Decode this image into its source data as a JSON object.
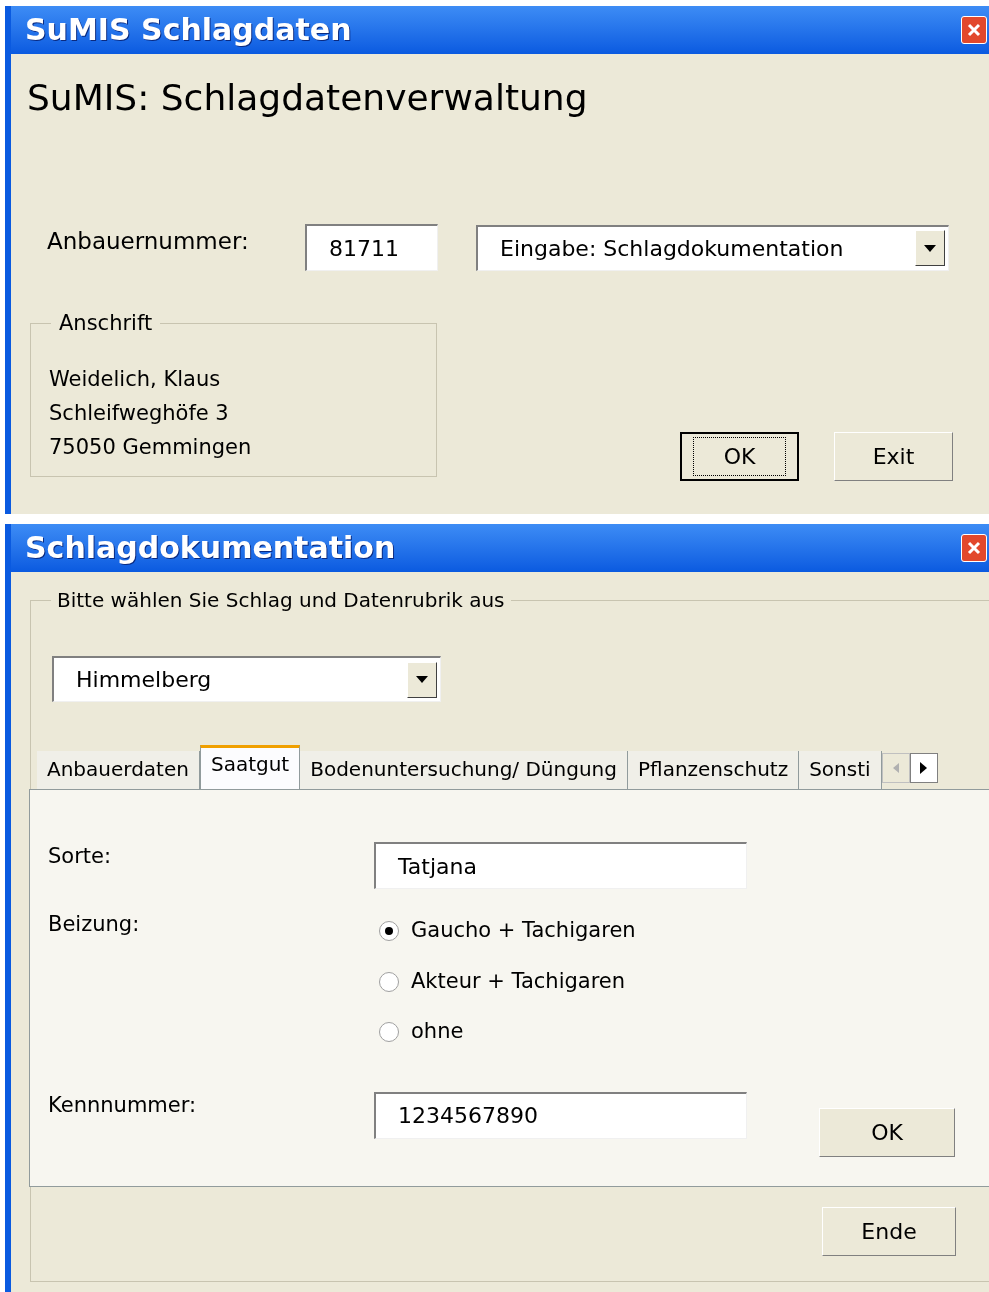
{
  "main_window": {
    "title": "SuMIS Schlagdaten",
    "heading": "SuMIS: Schlagdatenverwaltung",
    "grower_number": {
      "label": "Anbauernummer:",
      "value": "81711"
    },
    "mode_select": {
      "value": "Eingabe: Schlagdokumentation"
    },
    "address": {
      "legend": "Anschrift",
      "lines": [
        "Weidelich, Klaus",
        "Schleifweghöfe 3",
        "75050 Gemmingen"
      ]
    },
    "buttons": [
      {
        "label": "OK",
        "default": true
      },
      {
        "label": "Exit",
        "default": false
      }
    ]
  },
  "doc_window": {
    "title": "Schlagdokumentation",
    "group_legend": "Bitte wählen Sie Schlag und Datenrubrik aus",
    "field_select": {
      "value": "Himmelberg"
    },
    "tabs": [
      {
        "label": "Anbauerdaten",
        "selected": false
      },
      {
        "label": "Saatgut",
        "selected": true
      },
      {
        "label": "Bodenuntersuchung/ Düngung",
        "selected": false
      },
      {
        "label": "Pflanzenschutz",
        "selected": false
      },
      {
        "label": "Sonsti",
        "selected": false
      }
    ],
    "variety": {
      "label": "Sorte:",
      "value": "Tatjana"
    },
    "seed_treatment": {
      "label": "Beizung:",
      "options": [
        {
          "label": "Gaucho + Tachigaren",
          "selected": true
        },
        {
          "label": "Akteur + Tachigaren",
          "selected": false
        },
        {
          "label": "ohne",
          "selected": false
        }
      ]
    },
    "id_number": {
      "label": "Kennnummer:",
      "value": "1234567890"
    },
    "ok_button": "OK",
    "end_button": "Ende"
  }
}
